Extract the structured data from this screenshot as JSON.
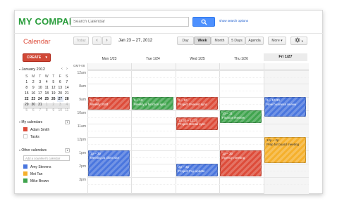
{
  "brand": {
    "name": "MY COMPANY"
  },
  "search": {
    "placeholder": "Search Calendar",
    "options_link": "show search options"
  },
  "toolbar": {
    "title": "Calendar",
    "today": "Today",
    "prev": "‹",
    "next": "›",
    "date_range": "Jan 23 – 27, 2012",
    "views": [
      "Day",
      "Week",
      "Month",
      "5 Days",
      "Agenda"
    ],
    "active_view": "Week",
    "more": "More",
    "more_arrow": "▾",
    "settings_arrow": "▾"
  },
  "sidebar": {
    "create_label": "CREATE",
    "create_arrow": "▾",
    "mini_cal": {
      "month_label": "January 2012",
      "collapse": "▾",
      "prev": "‹",
      "next": "›",
      "weekdays": [
        "S",
        "M",
        "T",
        "W",
        "T",
        "F",
        "S"
      ],
      "weeks": [
        [
          "1",
          "2",
          "3",
          "4",
          "5",
          "6",
          "7"
        ],
        [
          "8",
          "9",
          "10",
          "11",
          "12",
          "13",
          "14"
        ],
        [
          "15",
          "16",
          "17",
          "18",
          "19",
          "20",
          "21"
        ],
        [
          "22",
          "23",
          "24",
          "25",
          "26",
          "27",
          "28"
        ],
        [
          "29",
          "30",
          "31",
          "1",
          "2",
          "3",
          "4"
        ],
        [
          "5",
          "6",
          "7",
          "8",
          "9",
          "10",
          "11"
        ]
      ]
    },
    "my_calendars": {
      "label": "My calendars",
      "collapse": "▾",
      "menu": "▾",
      "items": [
        {
          "name": "Adam Smith",
          "color": "#dd4b39"
        },
        {
          "name": "Tasks",
          "color": "#ffffff"
        }
      ]
    },
    "other_calendars": {
      "label": "Other calendars",
      "collapse": "▾",
      "menu": "▾",
      "add_placeholder": "Add a coworker's calendar",
      "items": [
        {
          "name": "Amy Stevens",
          "color": "#4a76de"
        },
        {
          "name": "Mei Tan",
          "color": "#f5b02c"
        },
        {
          "name": "Mike Brown",
          "color": "#3fa34d"
        }
      ]
    }
  },
  "week": {
    "timezone": "GMT-08",
    "days": [
      "Mon 1/23",
      "Tue 1/24",
      "Wed 1/25",
      "Thu 1/26",
      "Fri 1/27"
    ],
    "hours": [
      "12am",
      "8am",
      "9am",
      "10am",
      "11am",
      "12pm",
      "1pm",
      "2pm",
      "3pm"
    ]
  },
  "events": [
    {
      "day": 0,
      "time": "9 – 10",
      "title": "Weekly Staff",
      "color": "red"
    },
    {
      "day": 0,
      "time": "1p – 3p",
      "title": "Meeting at client site",
      "color": "blue"
    },
    {
      "day": 1,
      "time": "9 – 10",
      "title": "Weekly a function sync",
      "color": "green"
    },
    {
      "day": 2,
      "time": "9 – 10",
      "title": "Project Everest sync",
      "color": "red"
    },
    {
      "day": 2,
      "time": "10:30 – 11:30",
      "title": "Project Denali sync",
      "color": "red"
    },
    {
      "day": 2,
      "time": "2p – 3p",
      "title": "Project Fuji update",
      "color": "blue"
    },
    {
      "day": 3,
      "time": "10 – 11",
      "title": "Finance Review",
      "color": "green"
    },
    {
      "day": 3,
      "time": "1p – 3p",
      "title": "Agency meeting",
      "color": "red"
    },
    {
      "day": 4,
      "time": "9 – 10:30",
      "title": "New business review",
      "color": "blue"
    },
    {
      "day": 4,
      "time": "12p – 2p",
      "title": "Prep for board meeting",
      "color": "orange"
    }
  ]
}
